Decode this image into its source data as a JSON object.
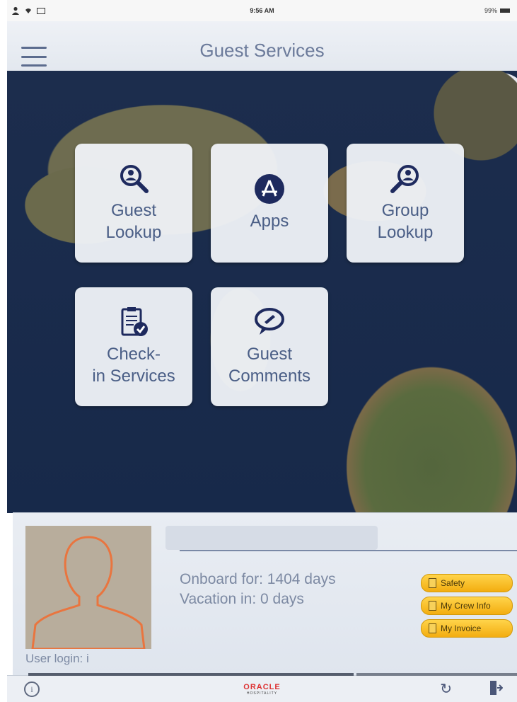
{
  "status": {
    "time": "9:56 AM",
    "battery": "99%"
  },
  "nav": {
    "title": "Guest Services"
  },
  "tiles": [
    {
      "line1": "Guest",
      "line2": "Lookup"
    },
    {
      "line1": "Apps",
      "line2": ""
    },
    {
      "line1": "Group",
      "line2": "Lookup"
    },
    {
      "line1": "Check-",
      "line2": "in Services"
    },
    {
      "line1": "Guest",
      "line2": "Comments"
    }
  ],
  "profile": {
    "onboard": "Onboard for: 1404 days",
    "vacation": "Vacation in: 0 days",
    "login": "User login: i",
    "buttons": [
      "Safety",
      "My Crew Info",
      "My Invoice"
    ]
  },
  "footer": {
    "brand": "ORACLE",
    "brand_sub": "HOSPITALITY",
    "info": "i"
  },
  "colors": {
    "accent": "#4a5e86",
    "button": "#f3ad10",
    "brand": "#dd3333"
  }
}
